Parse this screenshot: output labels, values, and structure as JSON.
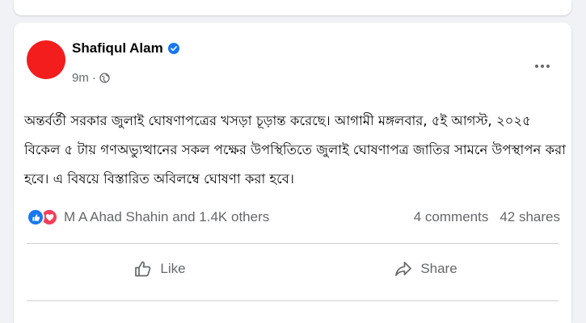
{
  "post": {
    "author": "Shafiqul Alam",
    "time": "9m",
    "separator": "·",
    "text": "অন্তর্বর্তী সরকার জুলাই ঘোষণাপত্রের খসড়া চূড়ান্ত করেছে। আগামী মঙ্গলবার, ৫ই আগস্ট, ২০২৫ বিকেল ৫ টায় গণঅভ্যুত্থানের সকল পক্ষের উপস্থিতিতে জুলাই ঘোষণাপত্র জাতির সামনে উপস্থাপন করা হবে। এ বিষয়ে বিস্তারিত অবিলম্বে ঘোষণা করা হবে।"
  },
  "engagement": {
    "reaction_names": "M A Ahad Shahin and 1.4K others",
    "comments": "4 comments",
    "shares": "42 shares"
  },
  "actions": {
    "like_label": "Like",
    "share_label": "Share"
  },
  "icons": {
    "verified": "verified-badge-icon",
    "audience": "globe-icon",
    "more": "more-options-icon",
    "like_reaction": "like-reaction-icon",
    "love_reaction": "love-reaction-icon",
    "like": "thumbs-up-icon",
    "share": "share-arrow-icon"
  },
  "colors": {
    "avatar": "#f31d1d",
    "verified": "#1877f2",
    "like_reaction": "#1877f2",
    "love_reaction": "#f33e58",
    "secondary_text": "#65676b"
  }
}
